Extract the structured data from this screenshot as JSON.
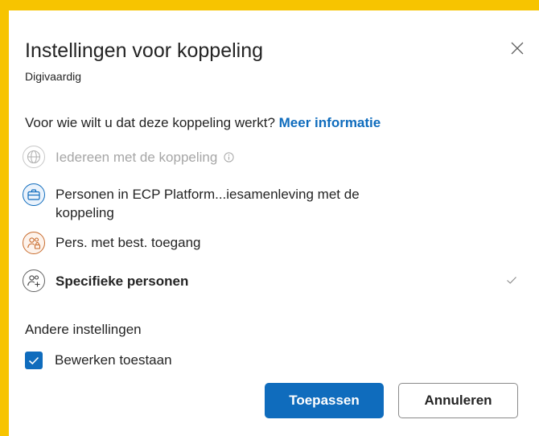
{
  "dialog": {
    "title": "Instellingen voor koppeling",
    "subtitle": "Digivaardig",
    "question": "Voor wie wilt u dat deze koppeling werkt?",
    "more_info_link": "Meer informatie"
  },
  "options": [
    {
      "label": "Iedereen met de koppeling",
      "icon": "globe-icon",
      "disabled": true,
      "info_icon": "info-icon"
    },
    {
      "label": "Personen in ECP Platform...iesamenleving met de koppeling",
      "icon": "briefcase-icon",
      "disabled": false
    },
    {
      "label": "Pers. met best. toegang",
      "icon": "people-lock-icon",
      "disabled": false
    },
    {
      "label": "Specifieke personen",
      "icon": "people-add-icon",
      "disabled": false,
      "selected": true
    }
  ],
  "other_settings": {
    "heading": "Andere instellingen",
    "allow_editing_label": "Bewerken toestaan",
    "allow_editing_checked": true
  },
  "buttons": {
    "apply": "Toepassen",
    "cancel": "Annuleren"
  },
  "colors": {
    "accent": "#0f6cbd",
    "frame": "#f7c400"
  }
}
